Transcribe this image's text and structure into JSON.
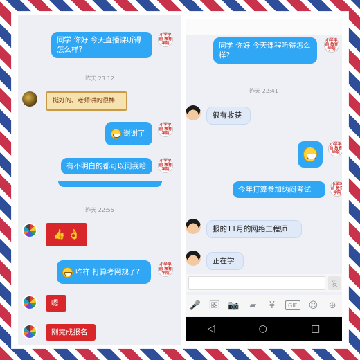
{
  "panel1": {
    "msg1": "同学 你好 今天直播课听得怎么样?",
    "time1": "昨天 23:12",
    "reply1": "挺好的。老师讲的很棒",
    "msg2": "谢谢了",
    "msg3": "有不明白的都可以问我哈",
    "school_avatar": "小学学前 教育学院"
  },
  "panel2": {
    "time": "昨天 22:55",
    "sticker_thumbs": "👍",
    "sticker_ok": "👌",
    "msg1": "咋样 打算考网规了?",
    "reply1": "嗯",
    "reply2": "刚完成报名"
  },
  "panel3": {
    "msg1": "同学 你好 今天课程听得怎么样?",
    "time": "昨天 22:41",
    "reply1": "很有收获",
    "msg2": "今年打算参加纳闷考试",
    "reply2": "报的11月的网络工程师",
    "reply3": "正在学",
    "send_label": "发",
    "tools": [
      "mic-icon",
      "image-icon",
      "camera-icon",
      "red-packet-icon",
      "yuan-icon",
      "gif-icon",
      "emoji-icon",
      "plus-icon"
    ],
    "tool_glyphs": [
      "🎤",
      "🖼",
      "📷",
      "▰",
      "¥",
      "GIF",
      "☺",
      "⊕"
    ],
    "nav_glyphs": [
      "◁",
      "○",
      "□"
    ]
  },
  "colors": {
    "bubble_out": "#2fa7f5",
    "bubble_in": "#dfe9f7",
    "stamp_red": "#c8324a",
    "stamp_blue": "#2f4e9a"
  }
}
